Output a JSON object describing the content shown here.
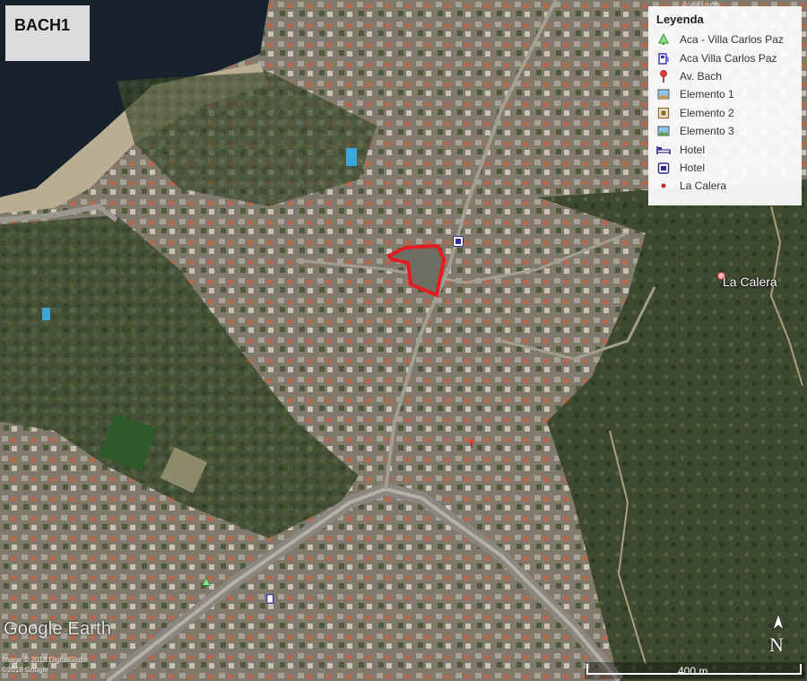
{
  "map": {
    "title": "BACH1",
    "legend": {
      "title": "Leyenda",
      "items": [
        {
          "label": "Aca - Villa Carlos Paz",
          "icon": "green-tree-icon"
        },
        {
          "label": "Aca Villa Carlos Paz",
          "icon": "gas-station-icon"
        },
        {
          "label": "Av. Bach",
          "icon": "red-pin-icon"
        },
        {
          "label": "Elemento 1",
          "icon": "photo-icon"
        },
        {
          "label": "Elemento 2",
          "icon": "square-marker-icon"
        },
        {
          "label": "Elemento 3",
          "icon": "photo-icon"
        },
        {
          "label": "Hotel",
          "icon": "bed-icon"
        },
        {
          "label": "Hotel",
          "icon": "building-icon"
        },
        {
          "label": "La Calera",
          "icon": "red-dot-icon"
        }
      ]
    },
    "place_label": "La Calera",
    "partial_label": "Av. Bach",
    "brand": "Google Earth",
    "credits": [
      "Image © 2018 DigitalGlobe",
      "©2018 Google"
    ],
    "scale_label": "400 m",
    "north_label": "N",
    "colors": {
      "lake": "#1a2430",
      "vegetation": "#3a4a2c",
      "urban": "#7d7a6e",
      "parcel_outline": "#e41b23"
    }
  }
}
